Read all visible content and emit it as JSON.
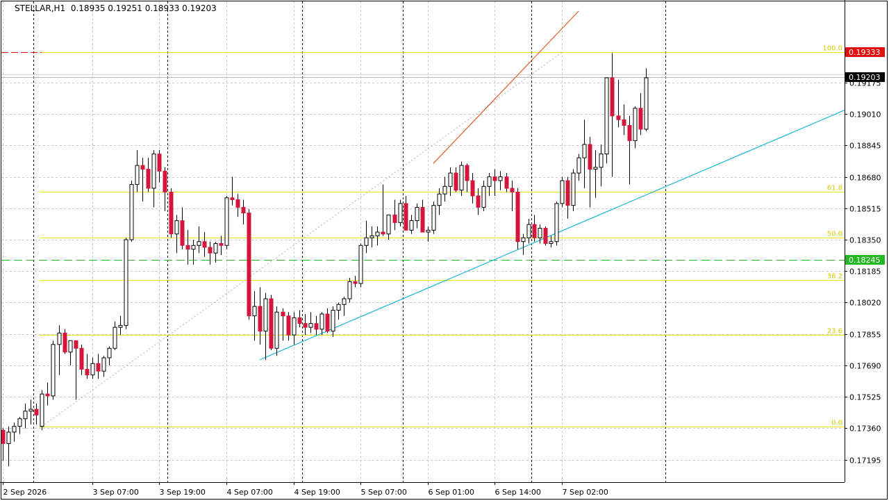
{
  "header": {
    "symbol": "STELLAR,H1",
    "ohlc": "0.18935 0.19251 0.18933 0.19203"
  },
  "colors": {
    "background": "#ffffff",
    "grid": "#c8c8c8",
    "bull_body": "#ffffff",
    "bear_body": "#d4163c",
    "candle_outline": "#000000",
    "fib_line": "#f2e600",
    "fib_label": "#d8c800",
    "trend_cyan": "#1eb6d8",
    "trend_red": "#e05a28",
    "green_level": "#25b825",
    "red_level": "#e01010",
    "price_tag_red": "#e01010",
    "price_tag_black": "#000000",
    "price_tag_green": "#25b825"
  },
  "chart_data": {
    "type": "candlestick",
    "symbol": "STELLAR",
    "timeframe": "H1",
    "ylim": [
      0.1711,
      0.1955
    ],
    "y_ticks": [
      "0.17195",
      "0.17360",
      "0.17525",
      "0.17690",
      "0.17855",
      "0.18020",
      "0.18185",
      "0.18350",
      "0.18515",
      "0.18680",
      "0.18845",
      "0.19010",
      "0.19175"
    ],
    "x_labels": [
      {
        "label": "2 Sep 2026",
        "bar": 0
      },
      {
        "label": "3 Sep 07:00",
        "bar": 16
      },
      {
        "label": "3 Sep 19:00",
        "bar": 28
      },
      {
        "label": "4 Sep 07:00",
        "bar": 40
      },
      {
        "label": "4 Sep 19:00",
        "bar": 52
      },
      {
        "label": "5 Sep 07:00",
        "bar": 64
      },
      {
        "label": "6 Sep 01:00",
        "bar": 76
      },
      {
        "label": "6 Sep 14:00",
        "bar": 88
      },
      {
        "label": "7 Sep 02:00",
        "bar": 100
      }
    ],
    "day_separators": [
      5,
      29,
      53,
      71,
      94,
      118
    ],
    "candles": [
      [
        0.1735,
        0.1736,
        0.1719,
        0.1728
      ],
      [
        0.1728,
        0.1737,
        0.1716,
        0.1734
      ],
      [
        0.1734,
        0.1739,
        0.1729,
        0.1737
      ],
      [
        0.1737,
        0.1742,
        0.1733,
        0.1741
      ],
      [
        0.1741,
        0.1749,
        0.1736,
        0.1745
      ],
      [
        0.1745,
        0.1751,
        0.1738,
        0.1746
      ],
      [
        0.1746,
        0.1749,
        0.1738,
        0.1743
      ],
      [
        0.1737,
        0.1756,
        0.1735,
        0.1754
      ],
      [
        0.1754,
        0.176,
        0.1748,
        0.1753
      ],
      [
        0.1753,
        0.1782,
        0.1751,
        0.178
      ],
      [
        0.178,
        0.179,
        0.1764,
        0.1786
      ],
      [
        0.1786,
        0.1788,
        0.1775,
        0.1776
      ],
      [
        0.1776,
        0.1782,
        0.1769,
        0.1782
      ],
      [
        0.1782,
        0.1782,
        0.1751,
        0.1778
      ],
      [
        0.1778,
        0.178,
        0.1764,
        0.1767
      ],
      [
        0.1767,
        0.1775,
        0.1762,
        0.1764
      ],
      [
        0.1764,
        0.1773,
        0.1762,
        0.177
      ],
      [
        0.177,
        0.1775,
        0.1762,
        0.1766
      ],
      [
        0.1766,
        0.1774,
        0.1763,
        0.1773
      ],
      [
        0.1773,
        0.1779,
        0.1769,
        0.1778
      ],
      [
        0.1778,
        0.1792,
        0.1777,
        0.1789
      ],
      [
        0.1789,
        0.1795,
        0.1785,
        0.179
      ],
      [
        0.179,
        0.1836,
        0.1788,
        0.1835
      ],
      [
        0.1835,
        0.1866,
        0.1834,
        0.1864
      ],
      [
        0.1864,
        0.1882,
        0.186,
        0.1874
      ],
      [
        0.1874,
        0.1878,
        0.1855,
        0.1872
      ],
      [
        0.1872,
        0.1878,
        0.186,
        0.1862
      ],
      [
        0.1862,
        0.1882,
        0.1852,
        0.188
      ],
      [
        0.188,
        0.1882,
        0.1865,
        0.1871
      ],
      [
        0.1871,
        0.1873,
        0.185,
        0.186
      ],
      [
        0.186,
        0.1862,
        0.1836,
        0.1838
      ],
      [
        0.1838,
        0.1848,
        0.1828,
        0.1845
      ],
      [
        0.1845,
        0.1852,
        0.183,
        0.1832
      ],
      [
        0.1832,
        0.184,
        0.1822,
        0.183
      ],
      [
        0.183,
        0.1835,
        0.1822,
        0.1832
      ],
      [
        0.1832,
        0.1842,
        0.1828,
        0.1834
      ],
      [
        0.1834,
        0.1839,
        0.1826,
        0.1831
      ],
      [
        0.1831,
        0.1834,
        0.1822,
        0.1828
      ],
      [
        0.1828,
        0.1834,
        0.1823,
        0.1833
      ],
      [
        0.1833,
        0.1837,
        0.1827,
        0.1832
      ],
      [
        0.1832,
        0.1858,
        0.183,
        0.1857
      ],
      [
        0.1857,
        0.1868,
        0.1853,
        0.1856
      ],
      [
        0.1856,
        0.1859,
        0.1847,
        0.1852
      ],
      [
        0.1852,
        0.1856,
        0.1843,
        0.1849
      ],
      [
        0.1849,
        0.1851,
        0.1793,
        0.1795
      ],
      [
        0.1795,
        0.1808,
        0.1782,
        0.18
      ],
      [
        0.18,
        0.181,
        0.178,
        0.1787
      ],
      [
        0.1787,
        0.1807,
        0.1772,
        0.1804
      ],
      [
        0.1804,
        0.1806,
        0.1777,
        0.1778
      ],
      [
        0.1778,
        0.18,
        0.1774,
        0.1797
      ],
      [
        0.1797,
        0.1799,
        0.1782,
        0.1795
      ],
      [
        0.1795,
        0.1797,
        0.1782,
        0.1785
      ],
      [
        0.1785,
        0.1797,
        0.178,
        0.1794
      ],
      [
        0.1794,
        0.1798,
        0.1789,
        0.1791
      ],
      [
        0.1791,
        0.1796,
        0.1785,
        0.1789
      ],
      [
        0.1789,
        0.1797,
        0.1786,
        0.1791
      ],
      [
        0.1791,
        0.1795,
        0.1785,
        0.1788
      ],
      [
        0.1788,
        0.1797,
        0.1785,
        0.1796
      ],
      [
        0.1796,
        0.1799,
        0.1786,
        0.1787
      ],
      [
        0.1787,
        0.18,
        0.1784,
        0.1798
      ],
      [
        0.1798,
        0.1802,
        0.1793,
        0.1801
      ],
      [
        0.1801,
        0.1805,
        0.1795,
        0.1804
      ],
      [
        0.1804,
        0.1815,
        0.1802,
        0.1813
      ],
      [
        0.1813,
        0.1816,
        0.181,
        0.1812
      ],
      [
        0.1812,
        0.1833,
        0.181,
        0.1832
      ],
      [
        0.1832,
        0.1845,
        0.1828,
        0.1836
      ],
      [
        0.1836,
        0.1842,
        0.1831,
        0.1837
      ],
      [
        0.1837,
        0.1842,
        0.1832,
        0.1839
      ],
      [
        0.1839,
        0.1864,
        0.1837,
        0.1838
      ],
      [
        0.1838,
        0.1846,
        0.1835,
        0.1848
      ],
      [
        0.1848,
        0.1856,
        0.184,
        0.1844
      ],
      [
        0.1844,
        0.1856,
        0.1842,
        0.1854
      ],
      [
        0.1854,
        0.1858,
        0.1843,
        0.184
      ],
      [
        0.184,
        0.1848,
        0.1838,
        0.1845
      ],
      [
        0.1845,
        0.1854,
        0.1841,
        0.1852
      ],
      [
        0.1852,
        0.1856,
        0.184,
        0.1839
      ],
      [
        0.1839,
        0.1842,
        0.1834,
        0.184
      ],
      [
        0.184,
        0.1855,
        0.1838,
        0.1853
      ],
      [
        0.1853,
        0.1862,
        0.1848,
        0.1859
      ],
      [
        0.1859,
        0.1868,
        0.1855,
        0.1863
      ],
      [
        0.1863,
        0.1873,
        0.1858,
        0.187
      ],
      [
        0.187,
        0.1873,
        0.186,
        0.1861
      ],
      [
        0.1861,
        0.1876,
        0.1858,
        0.1874
      ],
      [
        0.1874,
        0.1875,
        0.186,
        0.1866
      ],
      [
        0.1866,
        0.187,
        0.1854,
        0.1858
      ],
      [
        0.1858,
        0.1862,
        0.1848,
        0.1852
      ],
      [
        0.1852,
        0.1866,
        0.185,
        0.1863
      ],
      [
        0.1863,
        0.187,
        0.1858,
        0.1868
      ],
      [
        0.1868,
        0.1872,
        0.1858,
        0.1866
      ],
      [
        0.1866,
        0.1871,
        0.1861,
        0.1868
      ],
      [
        0.1868,
        0.187,
        0.186,
        0.1862
      ],
      [
        0.1862,
        0.1866,
        0.185,
        0.186
      ],
      [
        0.186,
        0.1862,
        0.183,
        0.1834
      ],
      [
        0.1834,
        0.1838,
        0.1827,
        0.1836
      ],
      [
        0.1836,
        0.1846,
        0.1833,
        0.1843
      ],
      [
        0.1843,
        0.1848,
        0.1834,
        0.1836
      ],
      [
        0.1836,
        0.1843,
        0.1833,
        0.1841
      ],
      [
        0.1841,
        0.1842,
        0.1832,
        0.1833
      ],
      [
        0.1833,
        0.1837,
        0.1831,
        0.1834
      ],
      [
        0.1834,
        0.1855,
        0.1832,
        0.1854
      ],
      [
        0.1854,
        0.1868,
        0.1852,
        0.1866
      ],
      [
        0.1866,
        0.1868,
        0.1846,
        0.1853
      ],
      [
        0.1853,
        0.1872,
        0.185,
        0.187
      ],
      [
        0.187,
        0.188,
        0.1866,
        0.1878
      ],
      [
        0.1878,
        0.1898,
        0.1862,
        0.1885
      ],
      [
        0.1885,
        0.1889,
        0.1852,
        0.1872
      ],
      [
        0.1872,
        0.1882,
        0.1857,
        0.1873
      ],
      [
        0.1873,
        0.1885,
        0.1863,
        0.188
      ],
      [
        0.188,
        0.1895,
        0.1875,
        0.192
      ],
      [
        0.192,
        0.1933,
        0.1868,
        0.19
      ],
      [
        0.19,
        0.1919,
        0.1894,
        0.1898
      ],
      [
        0.1898,
        0.1906,
        0.189,
        0.1895
      ],
      [
        0.1895,
        0.19,
        0.1864,
        0.1887
      ],
      [
        0.1887,
        0.1905,
        0.1883,
        0.1904
      ],
      [
        0.1904,
        0.1912,
        0.189,
        0.1893
      ],
      [
        0.1893,
        0.1925,
        0.1892,
        0.192
      ]
    ],
    "fibonacci": {
      "levels": [
        {
          "label": "100.0",
          "price": 0.19333
        },
        {
          "label": "61.8",
          "price": 0.186
        },
        {
          "label": "50.0",
          "price": 0.1836
        },
        {
          "label": "38.2",
          "price": 0.1814
        },
        {
          "label": "23.6",
          "price": 0.1785
        },
        {
          "label": "0.0",
          "price": 0.1737
        }
      ],
      "anchor_start": {
        "bar": 7,
        "price": 0.1737
      },
      "anchor_end": {
        "bar": 100,
        "price": 0.19333
      }
    },
    "trendlines": [
      {
        "name": "cyan-support",
        "from": {
          "bar": 46,
          "price": 0.1772
        },
        "to_edge_price": 0.1903,
        "extend_bar": 150
      },
      {
        "name": "red-trend",
        "from": {
          "bar": 77,
          "price": 0.1875
        },
        "to": {
          "bar": 103,
          "price": 0.1955
        }
      }
    ],
    "horizontal_levels": [
      {
        "name": "green-level",
        "price": 0.18245,
        "style": "dashed"
      },
      {
        "name": "red-level",
        "price": 0.19333,
        "style": "solid"
      },
      {
        "name": "bid-line",
        "price": 0.19203,
        "style": "solid"
      }
    ],
    "price_tags": [
      {
        "name": "red-price-tag",
        "label": "0.19333",
        "price": 0.19333,
        "kind": "red"
      },
      {
        "name": "current-price-tag",
        "label": "0.19203",
        "price": 0.19203,
        "kind": "black"
      },
      {
        "name": "green-price-tag",
        "label": "0.18245",
        "price": 0.18245,
        "kind": "green"
      }
    ]
  }
}
